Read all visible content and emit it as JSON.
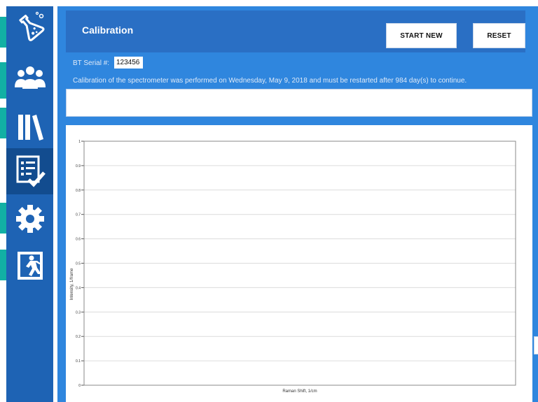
{
  "nav": {
    "items": [
      {
        "id": "lab",
        "icon": "flask-icon"
      },
      {
        "id": "users",
        "icon": "users-icon"
      },
      {
        "id": "library",
        "icon": "library-icon"
      },
      {
        "id": "calibration",
        "icon": "checklist-icon",
        "active": true
      },
      {
        "id": "settings",
        "icon": "gear-icon"
      },
      {
        "id": "exit",
        "icon": "exit-icon"
      }
    ]
  },
  "header": {
    "title": "Calibration",
    "start_new_label": "START NEW",
    "reset_label": "RESET"
  },
  "serial": {
    "label": "BT Serial #:",
    "value": "123456"
  },
  "message": "Calibration of the spectrometer was performed on Wednesday, May 9, 2018 and must be restarted after 984 day(s) to continue.",
  "status_text": "",
  "colors": {
    "sidebar": "#1e63b4",
    "sidebar_active": "#124c8f",
    "main": "#2f86de",
    "header": "#2a6fc4",
    "teal_accent": "#12b0a4"
  },
  "chart_data": {
    "type": "line",
    "xlabel": "Raman Shift, 1/cm",
    "ylabel": "Intensity, 1/frame",
    "ylim": [
      0,
      1
    ],
    "y_ticks": [
      "0",
      "0.1",
      "0.2",
      "0.3",
      "0.4",
      "0.5",
      "0.6",
      "0.7",
      "0.8",
      "0.9",
      "1"
    ],
    "series": [],
    "grid": true
  }
}
